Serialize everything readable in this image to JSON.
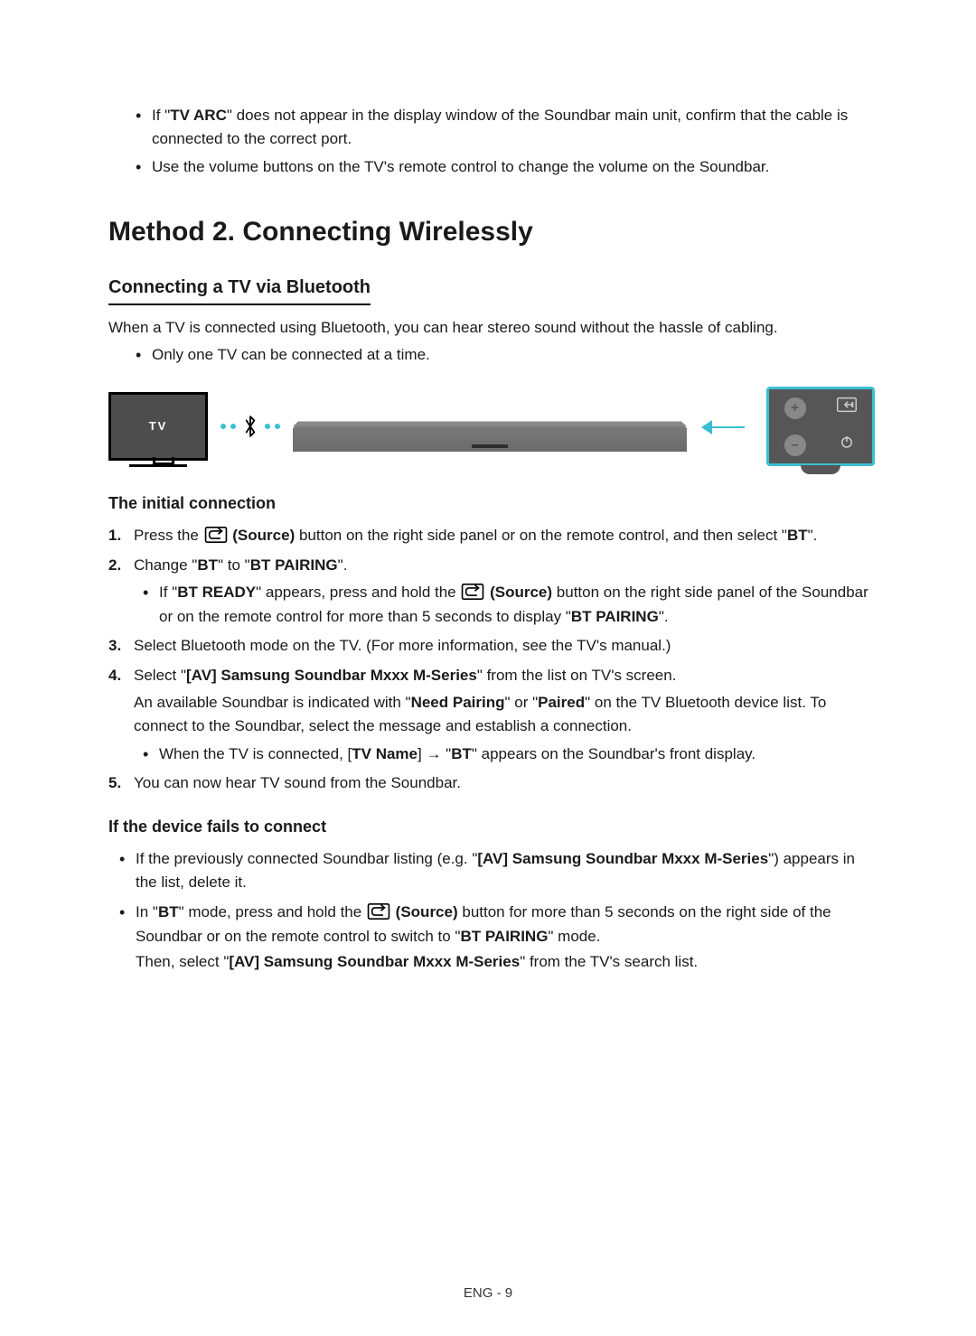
{
  "top_bullets": {
    "b1_part1": "If \"",
    "b1_strong": "TV ARC",
    "b1_part2": "\" does not appear in the display window of the Soundbar main unit, confirm that the cable is connected to the correct port.",
    "b2": "Use the volume buttons on the TV's remote control to change the volume on the Soundbar."
  },
  "method_heading": "Method 2. Connecting Wirelessly",
  "section_heading": "Connecting a TV via Bluetooth",
  "intro": "When a TV is connected using Bluetooth, you can hear stereo sound without the hassle of cabling.",
  "intro_bullet": "Only one TV can be connected at a time.",
  "diagram": {
    "tv_label": "TV"
  },
  "initial_heading": "The initial connection",
  "steps": {
    "s1": {
      "num": "1.",
      "t1": "Press the ",
      "source_label": " (Source)",
      "t2": " button on the right side panel or on the remote control, and then select \"",
      "bt": "BT",
      "t3": "\"."
    },
    "s2": {
      "num": "2.",
      "t1": "Change \"",
      "bt": "BT",
      "t2": "\" to \"",
      "btp": "BT PAIRING",
      "t3": "\".",
      "sub_t1": "If \"",
      "sub_strong1": "BT READY",
      "sub_t2": "\" appears, press and hold the ",
      "sub_source": " (Source)",
      "sub_t3": " button on the right side panel of the Soundbar or on the remote control for more than 5 seconds to display \"",
      "sub_strong2": "BT PAIRING",
      "sub_t4": "\"."
    },
    "s3": {
      "num": "3.",
      "text": "Select Bluetooth mode on the TV. (For more information, see the TV's manual.)"
    },
    "s4": {
      "num": "4.",
      "t1": "Select \"",
      "strong1": "[AV] Samsung Soundbar Mxxx M-Series",
      "t2": "\" from the list on TV's screen.",
      "line2a": "An available Soundbar is indicated with \"",
      "strong2": "Need Pairing",
      "line2b": "\" or \"",
      "strong3": "Paired",
      "line2c": "\" on the TV Bluetooth device list. To connect to the Soundbar, select the message and establish a connection.",
      "sub_t1": "When the TV is connected, [",
      "sub_strong1": "TV Name",
      "sub_t2": "] → \"",
      "sub_strong2": "BT",
      "sub_t3": "\" appears on the Soundbar's front display."
    },
    "s5": {
      "num": "5.",
      "text": "You can now hear TV sound from the Soundbar."
    }
  },
  "fails_heading": "If the device fails to connect",
  "fails": {
    "f1_t1": "If the previously connected Soundbar listing (e.g. \"",
    "f1_strong": "[AV] Samsung Soundbar Mxxx M-Series",
    "f1_t2": "\") appears in the list, delete it.",
    "f2_t1": "In \"",
    "f2_bt": "BT",
    "f2_t2": "\" mode, press and hold the ",
    "f2_source": " (Source)",
    "f2_t3": " button for more than 5 seconds on the right side of the Soundbar or on the remote control to switch to \"",
    "f2_btp": "BT PAIRING",
    "f2_t4": "\" mode.",
    "f2_line2a": "Then, select \"",
    "f2_strong2": "[AV] Samsung Soundbar Mxxx M-Series",
    "f2_line2b": "\" from the TV's search list."
  },
  "page_number": "ENG - 9"
}
